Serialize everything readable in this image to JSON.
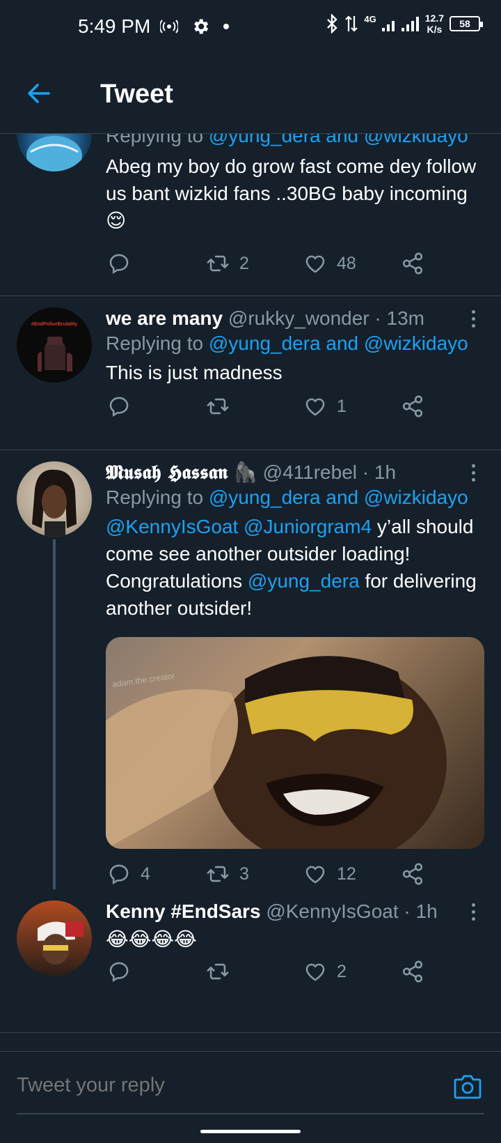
{
  "status_bar": {
    "time": "5:49 PM",
    "network": "4G",
    "speed_value": "12.7",
    "speed_unit": "K/s",
    "battery": "58"
  },
  "header": {
    "title": "Tweet"
  },
  "tweets": [
    {
      "reply_prefix": "Replying to",
      "reply_to": "@yung_dera and @wizkidayo",
      "text": "Abeg my boy do grow fast come dey follow us bant wizkid fans ..30BG baby incoming 😌",
      "replies": "",
      "retweets": "2",
      "likes": "48"
    },
    {
      "name": "we are many",
      "handle": "@rukky_wonder",
      "time": "13m",
      "avatar_label": "#EndPoliceBrutality",
      "reply_prefix": "Replying to",
      "reply_to": "@yung_dera and @wizkidayo",
      "text": "This is just madness",
      "replies": "",
      "retweets": "",
      "likes": "1"
    },
    {
      "name": "𝕸𝖚𝖘𝖆𝖍 𝕳𝖆𝖘𝖘𝖆𝖓",
      "name_emoji": "🦍",
      "handle": "@411rebel",
      "time": "1h",
      "reply_prefix": "Replying to",
      "reply_to": "@yung_dera and @wizkidayo",
      "text_mention_1": "@KennyIsGoat",
      "text_mention_2": "@Juniorgram4",
      "text_part_1": " y’all should come see another outsider loading! Congratulations ",
      "text_mention_3": "@yung_dera",
      "text_part_2": " for delivering another outsider!",
      "media_watermark": "adam.the.creator",
      "replies": "4",
      "retweets": "3",
      "likes": "12"
    },
    {
      "name": "Kenny #EndSars",
      "handle": "@KennyIsGoat",
      "time": "1h",
      "text": "😂😂😂😂",
      "replies": "",
      "retweets": "",
      "likes": "2"
    }
  ],
  "reply_bar": {
    "placeholder": "Tweet your reply"
  },
  "colors": {
    "background": "#15202b",
    "accent": "#1da1f2",
    "secondary_text": "#8899a6",
    "divider": "#38444d"
  }
}
